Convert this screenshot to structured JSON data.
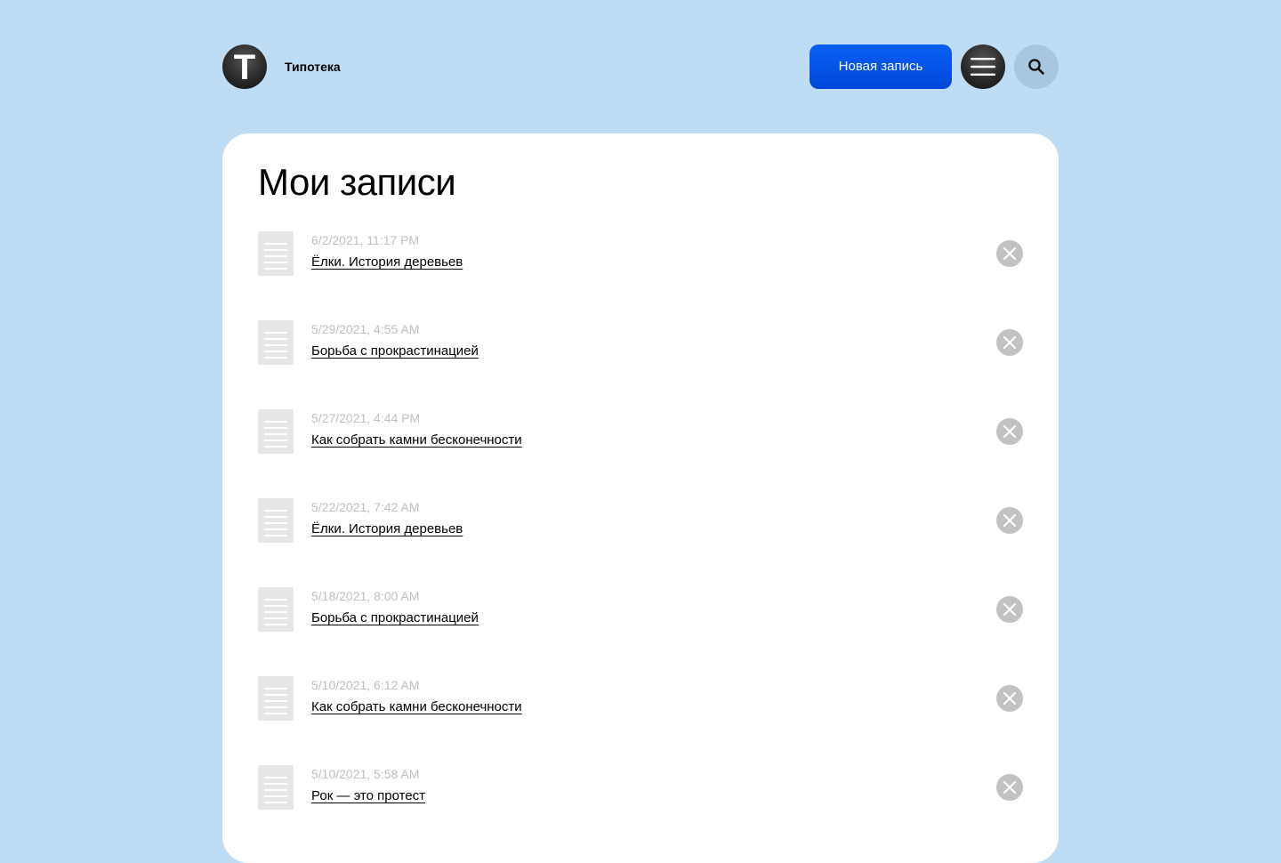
{
  "header": {
    "logo_letter": "T",
    "app_name": "Типотека",
    "new_post_label": "Новая запись",
    "menu_icon": "hamburger-menu-icon",
    "search_icon": "search-icon"
  },
  "main": {
    "title": "Мои записи",
    "items": [
      {
        "date": "6/2/2021, 11:17 PM",
        "title": "Ёлки. История деревьев"
      },
      {
        "date": "5/29/2021, 4:55 AM",
        "title": "Борьба с прокрастинацией"
      },
      {
        "date": "5/27/2021, 4:44 PM",
        "title": "Как собрать камни бесконечности"
      },
      {
        "date": "5/22/2021, 7:42 AM",
        "title": "Ёлки. История деревьев"
      },
      {
        "date": "5/18/2021, 8:00 AM",
        "title": "Борьба с прокрастинацией"
      },
      {
        "date": "5/10/2021, 6:12 AM",
        "title": "Как собрать камни бесконечности"
      },
      {
        "date": "5/10/2021, 5:58 AM",
        "title": "Рок — это протест"
      }
    ]
  },
  "colors": {
    "background": "#bfdcf5",
    "accent": "#0050e6",
    "muted": "#c0c0c0"
  }
}
